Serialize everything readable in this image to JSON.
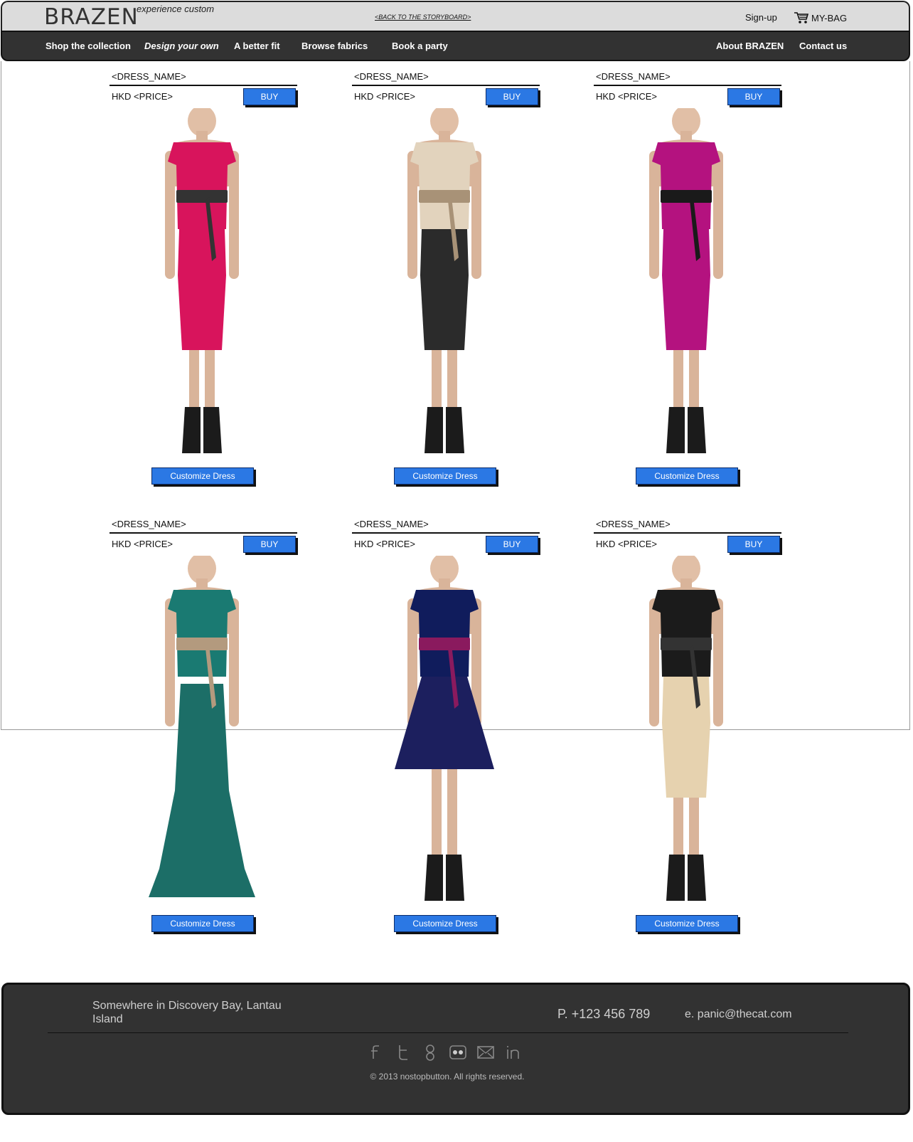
{
  "header": {
    "logo": "BRAZEN",
    "tagline": "experience custom",
    "storyboard_link": "<BACK TO THE STORYBOARD>",
    "signup": "Sign-up",
    "bag": "MY-BAG"
  },
  "nav": {
    "items": [
      "Shop the collection",
      "Design your own",
      "A better fit",
      "Browse fabrics",
      "Book a party"
    ],
    "right": [
      "About BRAZEN",
      "Contact us"
    ]
  },
  "products": [
    {
      "name": "<DRESS_NAME>",
      "price": "HKD <PRICE>",
      "buy": "BUY",
      "customize": "Customize Dress",
      "colors": {
        "top": "#d8145c",
        "skirt": "#d8145c",
        "belt": "#333333",
        "style": "pencil"
      }
    },
    {
      "name": "<DRESS_NAME>",
      "price": "HKD <PRICE>",
      "buy": "BUY",
      "customize": "Customize Dress",
      "colors": {
        "top": "#e2d3bd",
        "skirt": "#2b2b2b",
        "belt": "#a89277",
        "style": "pencil"
      }
    },
    {
      "name": "<DRESS_NAME>",
      "price": "HKD <PRICE>",
      "buy": "BUY",
      "customize": "Customize Dress",
      "colors": {
        "top": "#b4127f",
        "skirt": "#b4127f",
        "belt": "#1a1a1a",
        "style": "pencil"
      }
    },
    {
      "name": "<DRESS_NAME>",
      "price": "HKD <PRICE>",
      "buy": "BUY",
      "customize": "Customize Dress",
      "colors": {
        "top": "#1a7a72",
        "skirt": "#1c6e67",
        "belt": "#b39a7e",
        "style": "mermaid"
      }
    },
    {
      "name": "<DRESS_NAME>",
      "price": "HKD <PRICE>",
      "buy": "BUY",
      "customize": "Customize Dress",
      "colors": {
        "top": "#101c5c",
        "skirt": "#1c1f5e",
        "belt": "#8a1a5e",
        "style": "aline"
      }
    },
    {
      "name": "<DRESS_NAME>",
      "price": "HKD <PRICE>",
      "buy": "BUY",
      "customize": "Customize Dress",
      "colors": {
        "top": "#1b1b1b",
        "skirt": "#e6d2af",
        "belt": "#333333",
        "style": "pencil"
      }
    }
  ],
  "footer": {
    "address": "Somewhere in Discovery Bay, Lantau Island",
    "phone": "P. +123 456 789",
    "email": "e. panic@thecat.com",
    "socials": [
      "facebook-icon",
      "twitter-icon",
      "google-icon",
      "flickr-icon",
      "mail-icon",
      "linkedin-icon"
    ],
    "copyright": "© 2013 nostopbutton. All rights reserved."
  }
}
